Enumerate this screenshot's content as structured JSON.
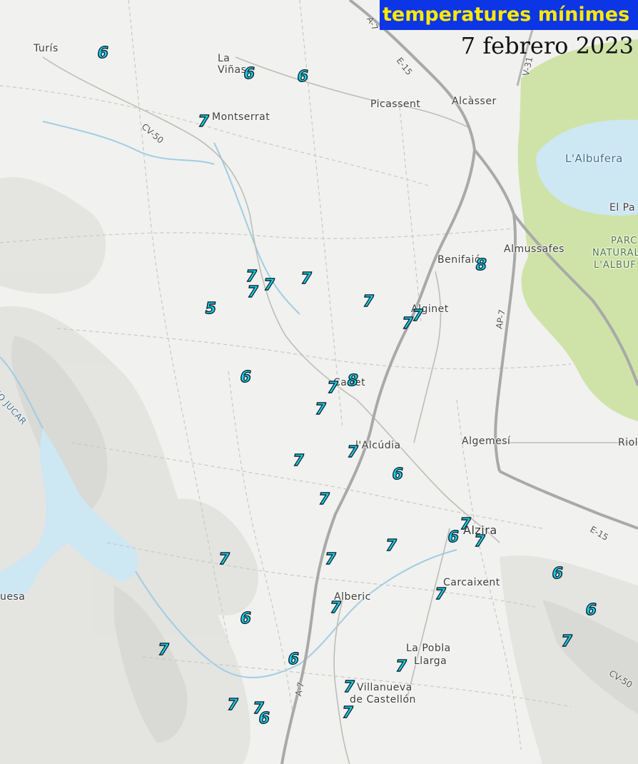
{
  "header": {
    "title": "temperatures mínimes",
    "date": "7 febrero 2023"
  },
  "colors": {
    "title_background": "#0c35e6",
    "title_text": "#ffea00",
    "marker_fill": "#1ed0e8",
    "water": "#cde7f3",
    "park": "#cfe3a8"
  },
  "places": {
    "turis": "Turís",
    "la_vinas": "La\nViñas",
    "montserrat": "Montserrat",
    "picassent": "Picassent",
    "alcasser": "Alcàsser",
    "albufera": "L'Albufera",
    "el_palmar": "El Pa",
    "parc_line1": "PARC",
    "parc_line2": "NATURAL",
    "parc_line3": "L'ALBUF",
    "benifaio": "Benifaió",
    "almussafes": "Almussafes",
    "alginet": "Alginet",
    "carlet": "Carlet",
    "alcudia": "l'Alcúdia",
    "algemesi": "Algemesí",
    "riola": "Riol",
    "alzira": "Alzira",
    "carcaixent": "Carcaixent",
    "alberic": "Alberic",
    "la_pobla_line1": "La Pobla",
    "la_pobla_line2": "Llarga",
    "villanueva_line1": "Villanueva",
    "villanueva_line2": "de Castellón",
    "tous": "uesa",
    "rio_jucar": "RIO JUCAR"
  },
  "roads": {
    "a7_north": "A-7",
    "e15_north": "E-15",
    "v31": "V-31",
    "cv50": "CV-50",
    "ap7": "AP-7",
    "e15_east": "E-15",
    "a7_south": "A-7",
    "cv50_east": "CV-50"
  },
  "icons": [
    "temperature-value-marker"
  ],
  "markers": [
    {
      "value": "6"
    },
    {
      "value": "6"
    },
    {
      "value": "6"
    },
    {
      "value": "7"
    },
    {
      "value": "7"
    },
    {
      "value": "7"
    },
    {
      "value": "7"
    },
    {
      "value": "7"
    },
    {
      "value": "5"
    },
    {
      "value": "7"
    },
    {
      "value": "7"
    },
    {
      "value": "7"
    },
    {
      "value": "8"
    },
    {
      "value": "6"
    },
    {
      "value": "8"
    },
    {
      "value": "7"
    },
    {
      "value": "7"
    },
    {
      "value": "7"
    },
    {
      "value": "7"
    },
    {
      "value": "6"
    },
    {
      "value": "7"
    },
    {
      "value": "7"
    },
    {
      "value": "6"
    },
    {
      "value": "7"
    },
    {
      "value": "7"
    },
    {
      "value": "7"
    },
    {
      "value": "7"
    },
    {
      "value": "6"
    },
    {
      "value": "6"
    },
    {
      "value": "7"
    },
    {
      "value": "6"
    },
    {
      "value": "7"
    },
    {
      "value": "6"
    },
    {
      "value": "7"
    },
    {
      "value": "7"
    },
    {
      "value": "7"
    },
    {
      "value": "7"
    },
    {
      "value": "6"
    },
    {
      "value": "7"
    },
    {
      "value": "7"
    },
    {
      "value": "7"
    }
  ]
}
